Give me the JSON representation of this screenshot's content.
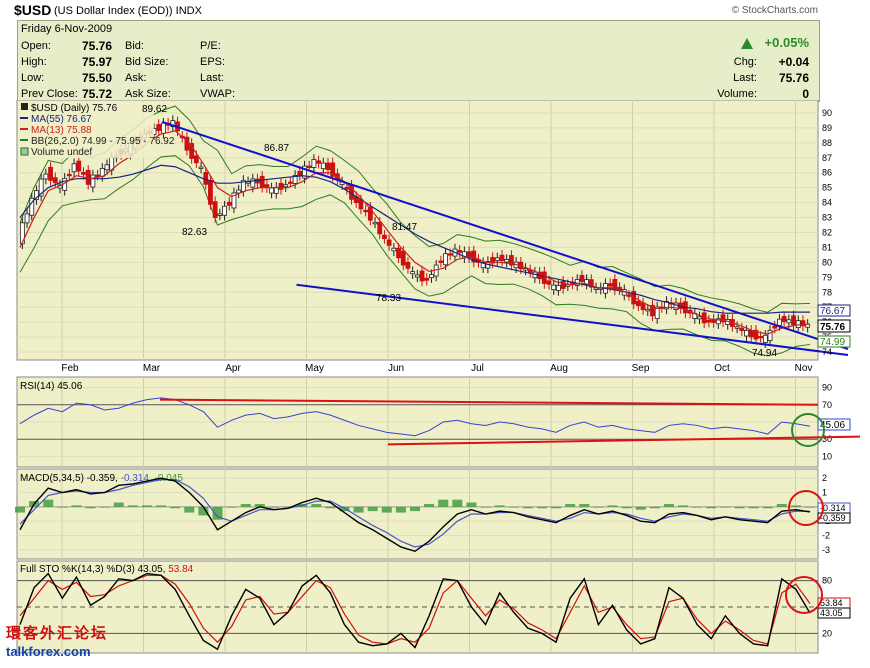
{
  "header": {
    "symbol": "$USD",
    "name": "(US Dollar Index (EOD))",
    "exchange": "INDX",
    "copyright": "© StockCharts.com"
  },
  "quote": {
    "date": "Friday  6-Nov-2009",
    "open_label": "Open:",
    "open": "75.76",
    "high_label": "High:",
    "high": "75.97",
    "low_label": "Low:",
    "low": "75.50",
    "prevclose_label": "Prev Close:",
    "prevclose": "75.72",
    "bid_label": "Bid:",
    "bidsize_label": "Bid Size:",
    "ask_label": "Ask:",
    "asksize_label": "Ask Size:",
    "pe_label": "P/E:",
    "eps_label": "EPS:",
    "last_label": "Last:",
    "vwap_label": "VWAP:",
    "change_pct": "+0.05%",
    "chg_label": "Chg:",
    "chg": "+0.04",
    "last2_label": "Last:",
    "last": "75.76",
    "volume_label": "Volume:",
    "volume": "0"
  },
  "legend": {
    "price": "$USD (Daily) 75.76",
    "ma55": "MA(55) 76.67",
    "ma13": "MA(13) 75.88",
    "bb": "BB(26,2.0) 74.99 - 75.95 - 76.92",
    "volume": "Volume undef",
    "rsi": "RSI(14) 45.06",
    "macd_a": "MACD(5,34,5) -0.359, ",
    "macd_b": "-0.314, ",
    "macd_c": "-0.045",
    "sto_a": "Full STO %K(14,3) %D(3) 43.05, ",
    "sto_b": "53.84"
  },
  "annotations": {
    "a1": "89.62",
    "a2": "86.87",
    "a3": "82.63",
    "a4": "81.47",
    "a5": "78.33",
    "a6": "74.94"
  },
  "price_badges": {
    "b1": "76.67",
    "b2": "75.76",
    "b3": "74.99"
  },
  "rsi_badge": "45.06",
  "macd_badges": {
    "b1": "-0.314",
    "b2": "-0.359"
  },
  "sto_badges": {
    "b1": "53.84",
    "b2": "43.05"
  },
  "watermark": {
    "cn": "環客外汇论坛",
    "url": "talkforex.com"
  },
  "colors": {
    "panel_bg": "#efefc8",
    "price_up": "#222222",
    "price_down": "#cc1111",
    "ma55": "#1a237e",
    "ma13": "#cc2222",
    "bb": "#2e7d1e",
    "trendline": "#1111cc",
    "rsi_line": "#3344cc",
    "rsi_trend": "#dd1111",
    "macd_line": "#000000",
    "macd_signal": "#4455cc",
    "macd_hist": "#3a9a3a",
    "sto_k": "#000000",
    "sto_d": "#cc1111"
  },
  "chart_data": {
    "type": "line",
    "title": "$USD (US Dollar Index (EOD))",
    "x_ticks": [
      "Feb",
      "Mar",
      "Apr",
      "May",
      "Jun",
      "Jul",
      "Aug",
      "Sep",
      "Oct",
      "Nov"
    ],
    "price_panel": {
      "y_ticks": [
        74,
        75,
        76,
        77,
        78,
        79,
        80,
        81,
        82,
        83,
        84,
        85,
        86,
        87,
        88,
        89,
        90
      ],
      "ylim": [
        73.6,
        90.6
      ],
      "series": [
        {
          "name": "$USD (Daily)",
          "values": [
            81.6,
            84.2,
            86.0,
            85.0,
            86.6,
            85.4,
            86.2,
            87.2,
            87.8,
            88.6,
            89.0,
            89.4,
            87.6,
            86.2,
            83.0,
            84.0,
            85.4,
            85.4,
            84.8,
            85.2,
            86.0,
            86.8,
            86.3,
            85.2,
            84.0,
            83.0,
            81.5,
            80.4,
            79.2,
            78.8,
            80.2,
            80.8,
            80.4,
            79.8,
            80.3,
            80.0,
            79.5,
            79.0,
            78.3,
            78.5,
            78.9,
            78.2,
            78.5,
            78.0,
            77.1,
            76.6,
            77.3,
            77.0,
            76.4,
            76.0,
            76.2,
            75.6,
            75.1,
            74.94,
            76.2,
            76.0,
            75.76
          ]
        },
        {
          "name": "MA(55)",
          "values": [
            83.0,
            84.2,
            85.0,
            85.4,
            85.6,
            85.6,
            85.6,
            85.7,
            85.9,
            86.2,
            86.5,
            86.4,
            86.0,
            85.6,
            85.3,
            85.3,
            85.4,
            85.5,
            85.6,
            85.7,
            85.8,
            85.7,
            85.4,
            84.9,
            84.3,
            83.7,
            83.1,
            82.5,
            81.9,
            81.4,
            81.0,
            80.6,
            80.2,
            79.9,
            79.7,
            79.5,
            79.3,
            79.1,
            78.9,
            78.7,
            78.5,
            78.3,
            78.2,
            78.0,
            77.8,
            77.5,
            77.3,
            77.0,
            76.9,
            76.7,
            76.6,
            76.6,
            76.6,
            76.6,
            76.67,
            76.67,
            76.67
          ]
        },
        {
          "name": "MA(13)",
          "values": [
            81.0,
            83.0,
            84.8,
            85.2,
            85.8,
            85.6,
            85.8,
            86.6,
            87.2,
            88.0,
            88.6,
            88.8,
            88.0,
            86.6,
            85.0,
            84.4,
            84.8,
            85.0,
            85.0,
            85.0,
            85.4,
            86.0,
            86.0,
            85.4,
            84.5,
            83.4,
            82.2,
            81.0,
            80.0,
            79.4,
            79.6,
            80.2,
            80.4,
            80.0,
            80.0,
            79.9,
            79.6,
            79.2,
            78.7,
            78.5,
            78.6,
            78.3,
            78.3,
            78.0,
            77.4,
            76.9,
            77.0,
            76.9,
            76.5,
            76.2,
            76.1,
            75.8,
            75.4,
            75.2,
            75.6,
            75.8,
            75.88
          ]
        }
      ],
      "trendlines": [
        {
          "from": [
            0.3,
            89.4
          ],
          "to": [
            1.0,
            74.2
          ]
        },
        {
          "from": [
            0.4,
            78.5
          ],
          "to": [
            1.0,
            73.8
          ]
        }
      ]
    },
    "rsi_panel": {
      "y_ticks": [
        10,
        30,
        50,
        70,
        90
      ],
      "ylim": [
        0,
        100
      ],
      "series": [
        {
          "name": "RSI(14)",
          "values": [
            48,
            58,
            66,
            62,
            72,
            70,
            64,
            66,
            72,
            76,
            78,
            76,
            70,
            62,
            44,
            52,
            58,
            60,
            54,
            56,
            60,
            62,
            58,
            52,
            46,
            42,
            38,
            36,
            34,
            40,
            50,
            52,
            48,
            46,
            50,
            48,
            44,
            42,
            38,
            46,
            50,
            44,
            46,
            42,
            40,
            38,
            46,
            48,
            46,
            42,
            44,
            42,
            40,
            36,
            50,
            48,
            45.06
          ]
        }
      ]
    },
    "macd_panel": {
      "y_ticks": [
        -3,
        -2,
        -1,
        0,
        1,
        2
      ],
      "ylim": [
        -3.5,
        2.5
      ],
      "series": [
        {
          "name": "MACD(5,34,5)",
          "values": [
            -1.6,
            0.2,
            1.3,
            1.0,
            1.2,
            0.9,
            1.0,
            1.5,
            1.6,
            1.8,
            2.0,
            1.8,
            1.0,
            0.0,
            -1.6,
            -1.0,
            -0.4,
            0.0,
            -0.2,
            -0.1,
            0.3,
            0.6,
            0.3,
            -0.4,
            -1.1,
            -1.6,
            -2.2,
            -2.8,
            -3.1,
            -2.4,
            -1.4,
            -0.5,
            -0.2,
            -0.5,
            -0.3,
            -0.4,
            -0.7,
            -0.9,
            -1.1,
            -0.6,
            -0.2,
            -0.5,
            -0.3,
            -0.6,
            -1.0,
            -1.1,
            -0.5,
            -0.4,
            -0.6,
            -0.9,
            -0.7,
            -0.9,
            -1.0,
            -1.1,
            -0.3,
            -0.2,
            -0.359
          ]
        },
        {
          "name": "Signal",
          "values": [
            -1.2,
            -0.2,
            0.8,
            1.0,
            1.1,
            1.0,
            1.0,
            1.2,
            1.5,
            1.7,
            1.9,
            1.9,
            1.4,
            0.6,
            -0.7,
            -1.0,
            -0.6,
            -0.2,
            -0.2,
            -0.1,
            0.1,
            0.4,
            0.4,
            -0.1,
            -0.7,
            -1.3,
            -1.8,
            -2.4,
            -2.8,
            -2.6,
            -1.9,
            -1.0,
            -0.5,
            -0.5,
            -0.4,
            -0.4,
            -0.6,
            -0.8,
            -1.0,
            -0.8,
            -0.4,
            -0.5,
            -0.4,
            -0.5,
            -0.8,
            -1.0,
            -0.7,
            -0.5,
            -0.6,
            -0.8,
            -0.7,
            -0.8,
            -0.9,
            -1.0,
            -0.5,
            -0.3,
            -0.314
          ]
        },
        {
          "name": "Histogram",
          "values": [
            -0.4,
            0.4,
            0.5,
            0.0,
            0.1,
            -0.1,
            0.0,
            0.3,
            0.1,
            0.1,
            0.1,
            -0.1,
            -0.4,
            -0.6,
            -0.9,
            0.0,
            0.2,
            0.2,
            0.0,
            0.0,
            0.2,
            0.2,
            -0.1,
            -0.3,
            -0.4,
            -0.3,
            -0.4,
            -0.4,
            -0.3,
            0.2,
            0.5,
            0.5,
            0.3,
            0.0,
            0.1,
            0.0,
            -0.1,
            -0.1,
            -0.1,
            0.2,
            0.2,
            0.0,
            0.1,
            -0.1,
            -0.2,
            -0.1,
            0.2,
            0.1,
            0.0,
            -0.1,
            0.0,
            -0.1,
            -0.1,
            -0.1,
            0.2,
            0.1,
            -0.045
          ]
        }
      ]
    },
    "sto_panel": {
      "y_ticks": [
        20,
        50,
        80
      ],
      "ylim": [
        0,
        100
      ],
      "series": [
        {
          "name": "%K",
          "values": [
            30,
            72,
            88,
            60,
            84,
            52,
            62,
            82,
            80,
            88,
            86,
            70,
            40,
            12,
            2,
            40,
            70,
            60,
            30,
            44,
            74,
            86,
            66,
            30,
            10,
            6,
            8,
            20,
            4,
            40,
            82,
            80,
            50,
            30,
            66,
            44,
            26,
            20,
            10,
            60,
            82,
            30,
            52,
            24,
            8,
            14,
            72,
            60,
            30,
            14,
            40,
            20,
            8,
            6,
            82,
            70,
            43.05
          ]
        },
        {
          "name": "%D",
          "values": [
            40,
            60,
            80,
            70,
            78,
            62,
            64,
            74,
            80,
            86,
            86,
            76,
            54,
            26,
            10,
            28,
            58,
            62,
            42,
            44,
            62,
            80,
            72,
            42,
            18,
            10,
            8,
            14,
            10,
            26,
            66,
            80,
            60,
            40,
            58,
            48,
            32,
            24,
            14,
            44,
            74,
            44,
            50,
            30,
            14,
            16,
            56,
            60,
            36,
            20,
            34,
            24,
            12,
            8,
            66,
            76,
            53.84
          ]
        }
      ]
    }
  }
}
